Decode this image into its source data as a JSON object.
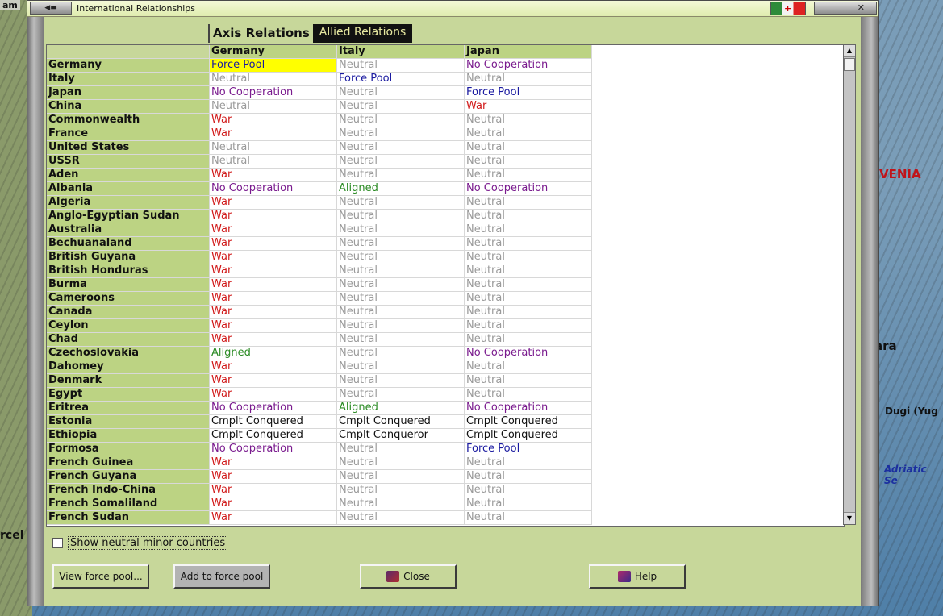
{
  "window": {
    "title": "International Relationships",
    "flag_mark": "+"
  },
  "map_labels": {
    "venia": "VENIA",
    "ara": "ara",
    "dugi": "Dugi (Yug",
    "adriatic": "Adriatic Se",
    "rcel": "rcel",
    "am": "am"
  },
  "tabs": [
    {
      "label": "Axis Relations",
      "active": true
    },
    {
      "label": "Allied Relations",
      "active": false
    }
  ],
  "columns": [
    "Germany",
    "Italy",
    "Japan"
  ],
  "rows": [
    {
      "country": "Germany",
      "values": [
        "Force Pool",
        "Neutral",
        "No Cooperation"
      ]
    },
    {
      "country": "Italy",
      "values": [
        "Neutral",
        "Force Pool",
        "Neutral"
      ]
    },
    {
      "country": "Japan",
      "values": [
        "No Cooperation",
        "Neutral",
        "Force Pool"
      ]
    },
    {
      "country": "China",
      "values": [
        "Neutral",
        "Neutral",
        "War"
      ]
    },
    {
      "country": "Commonwealth",
      "values": [
        "War",
        "Neutral",
        "Neutral"
      ]
    },
    {
      "country": "France",
      "values": [
        "War",
        "Neutral",
        "Neutral"
      ]
    },
    {
      "country": "United States",
      "values": [
        "Neutral",
        "Neutral",
        "Neutral"
      ]
    },
    {
      "country": "USSR",
      "values": [
        "Neutral",
        "Neutral",
        "Neutral"
      ]
    },
    {
      "country": "Aden",
      "values": [
        "War",
        "Neutral",
        "Neutral"
      ]
    },
    {
      "country": "Albania",
      "values": [
        "No Cooperation",
        "Aligned",
        "No Cooperation"
      ]
    },
    {
      "country": "Algeria",
      "values": [
        "War",
        "Neutral",
        "Neutral"
      ]
    },
    {
      "country": "Anglo-Egyptian Sudan",
      "values": [
        "War",
        "Neutral",
        "Neutral"
      ]
    },
    {
      "country": "Australia",
      "values": [
        "War",
        "Neutral",
        "Neutral"
      ]
    },
    {
      "country": "Bechuanaland",
      "values": [
        "War",
        "Neutral",
        "Neutral"
      ]
    },
    {
      "country": "British Guyana",
      "values": [
        "War",
        "Neutral",
        "Neutral"
      ]
    },
    {
      "country": "British Honduras",
      "values": [
        "War",
        "Neutral",
        "Neutral"
      ]
    },
    {
      "country": "Burma",
      "values": [
        "War",
        "Neutral",
        "Neutral"
      ]
    },
    {
      "country": "Cameroons",
      "values": [
        "War",
        "Neutral",
        "Neutral"
      ]
    },
    {
      "country": "Canada",
      "values": [
        "War",
        "Neutral",
        "Neutral"
      ]
    },
    {
      "country": "Ceylon",
      "values": [
        "War",
        "Neutral",
        "Neutral"
      ]
    },
    {
      "country": "Chad",
      "values": [
        "War",
        "Neutral",
        "Neutral"
      ]
    },
    {
      "country": "Czechoslovakia",
      "values": [
        "Aligned",
        "Neutral",
        "No Cooperation"
      ]
    },
    {
      "country": "Dahomey",
      "values": [
        "War",
        "Neutral",
        "Neutral"
      ]
    },
    {
      "country": "Denmark",
      "values": [
        "War",
        "Neutral",
        "Neutral"
      ]
    },
    {
      "country": "Egypt",
      "values": [
        "War",
        "Neutral",
        "Neutral"
      ]
    },
    {
      "country": "Eritrea",
      "values": [
        "No Cooperation",
        "Aligned",
        "No Cooperation"
      ]
    },
    {
      "country": "Estonia",
      "values": [
        "Cmplt Conquered",
        "Cmplt Conquered",
        "Cmplt Conquered"
      ]
    },
    {
      "country": "Ethiopia",
      "values": [
        "Cmplt Conquered",
        "Cmplt Conqueror",
        "Cmplt Conquered"
      ]
    },
    {
      "country": "Formosa",
      "values": [
        "No Cooperation",
        "Neutral",
        "Force Pool"
      ]
    },
    {
      "country": "French Guinea",
      "values": [
        "War",
        "Neutral",
        "Neutral"
      ]
    },
    {
      "country": "French Guyana",
      "values": [
        "War",
        "Neutral",
        "Neutral"
      ]
    },
    {
      "country": "French Indo-China",
      "values": [
        "War",
        "Neutral",
        "Neutral"
      ]
    },
    {
      "country": "French Somaliland",
      "values": [
        "War",
        "Neutral",
        "Neutral"
      ]
    },
    {
      "country": "French Sudan",
      "values": [
        "War",
        "Neutral",
        "Neutral"
      ]
    }
  ],
  "checkbox": {
    "label": "Show neutral minor countries",
    "checked": false
  },
  "buttons": {
    "view": "View force pool...",
    "add": "Add to force pool",
    "close": "Close",
    "help": "Help"
  },
  "colors": {
    "force_pool": "#1a1aa0",
    "neutral": "#9a9a9a",
    "no_cooperation": "#7a1b8e",
    "war": "#d11a1a",
    "aligned": "#2b8b24",
    "highlight": "#ffff00"
  }
}
